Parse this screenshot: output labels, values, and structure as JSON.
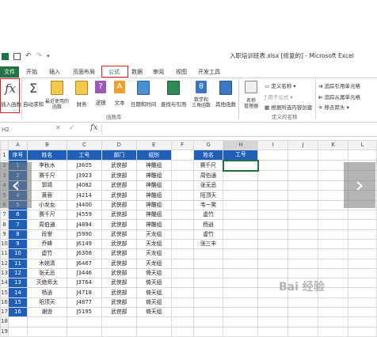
{
  "window": {
    "title": "入职培训班表.xlsx  [修复的]  - Microsoft Excel"
  },
  "tabs": [
    "文件",
    "开始",
    "插入",
    "页面布局",
    "公式",
    "数据",
    "审阅",
    "视图",
    "开发工具"
  ],
  "active_tab": "公式",
  "ribbon": {
    "insert_function": "插入函数",
    "autosum": "自动求和",
    "recent": "最近使用的\n函数",
    "financial": "财务",
    "logical": "逻辑",
    "text": "文本",
    "datetime": "日期和时间",
    "lookup": "查找与引用",
    "math": "数学和\n三角函数",
    "other": "其他函数",
    "name_manager": "名称\n管理器",
    "define_name": "定义名称",
    "use_in_formula": "用于公式",
    "create_from_selection": "根据所选内容创建",
    "trace_precedents": "追踪引用单元格",
    "trace_dependents": "追踪从属单元格",
    "remove_arrows": "移去箭头",
    "group_library": "函数库",
    "group_defined_names": "定义的名称"
  },
  "formula_bar": {
    "name_box": "H2",
    "fx": "fx",
    "formula": ""
  },
  "sheet": {
    "columns": [
      "A",
      "B",
      "C",
      "D",
      "E",
      "F",
      "G",
      "H",
      "I",
      "J",
      "K",
      "L"
    ],
    "selected_column": "H",
    "row_numbers": [
      "1",
      "2",
      "3",
      "4",
      "5",
      "6",
      "7",
      "8",
      "9",
      "10",
      "11",
      "12",
      "13",
      "14",
      "15",
      "16",
      "17",
      "18",
      "19"
    ],
    "table_headers": [
      "序号",
      "姓名",
      "工号",
      "部门",
      "组别"
    ],
    "rows": [
      [
        "1",
        "李秋水",
        "J3605",
        "武侠部",
        "神雕组"
      ],
      [
        "2",
        "赛千尺",
        "J3923",
        "武侠部",
        "神雕组"
      ],
      [
        "3",
        "郭靖",
        "J4082",
        "武侠部",
        "神雕组"
      ],
      [
        "4",
        "黄蓉",
        "J4214",
        "武侠部",
        "神雕组"
      ],
      [
        "5",
        "小龙女",
        "J4400",
        "武侠部",
        "神雕组"
      ],
      [
        "6",
        "赛千尺",
        "J4559",
        "武侠部",
        "神雕组"
      ],
      [
        "7",
        "周伯通",
        "J4894",
        "武侠部",
        "神雕组"
      ],
      [
        "8",
        "段誉",
        "J5990",
        "武侠部",
        "天龙组"
      ],
      [
        "9",
        "乔峰",
        "J6149",
        "武侠部",
        "天龙组"
      ],
      [
        "10",
        "虚竹",
        "J6308",
        "武侠部",
        "天龙组"
      ],
      [
        "11",
        "木婉清",
        "J6467",
        "武侠部",
        "天龙组"
      ],
      [
        "12",
        "张无忌",
        "J3446",
        "武侠部",
        "倚天组"
      ],
      [
        "13",
        "灭绝师太",
        "J3764",
        "武侠部",
        "倚天组"
      ],
      [
        "14",
        "杨逍",
        "J4718",
        "武侠部",
        "倚天组"
      ],
      [
        "15",
        "阳顶天",
        "J4877",
        "武侠部",
        "倚天组"
      ],
      [
        "16",
        "谢逊",
        "J5195",
        "武侠部",
        "倚天组"
      ]
    ],
    "lookup_headers": [
      "姓名",
      "工号"
    ],
    "lookup_names": [
      "赛千尺",
      "周伯通",
      "张无忌",
      "阳顶天",
      "韦一笑",
      "虚竹",
      "杨逍",
      "虚竹",
      "张三丰"
    ]
  },
  "watermark": "Bai 经验",
  "colors": {
    "excel_green": "#217346",
    "header_blue": "#1f5fb8",
    "highlight_red": "#e02020"
  }
}
